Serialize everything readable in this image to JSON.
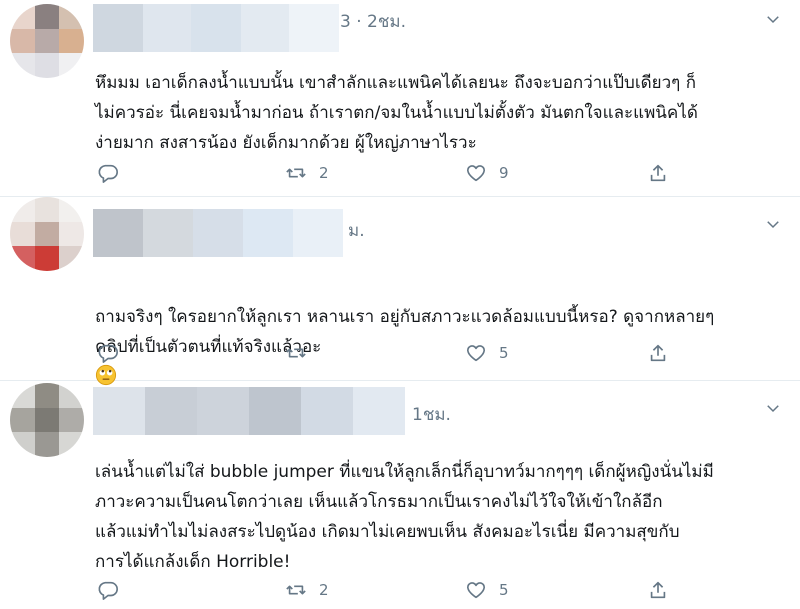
{
  "tweets": [
    {
      "time": "3 · 2ชม.",
      "text": "หึมมม เอาเด็กลงน้ำแบบนั้น เขาสำลักและแพนิคได้เลยนะ ถึงจะบอกว่าแป๊บเดียวๆ ก็\nไม่ควรอ่ะ นี่เคยจมน้ำมาก่อน ถ้าเราตก/จมในน้ำแบบไม่ตั้งตัว มันตกใจและแพนิคได้\nง่ายมาก สงสารน้อง ยังเด็กมากด้วย ผู้ใหญ่ภาษาไรวะ",
      "retweets": "2",
      "likes": "9"
    },
    {
      "time": "ม.",
      "text": "ถามจริงๆ ใครอยากให้ลูกเรา หลานเรา อยู่กับสภาวะแวดล้อมแบบนี้หรอ? ดูจากหลายๆ\nคลิปที่เป็นตัวตนที่แท้จริงแล้วอะ",
      "retweets": "",
      "likes": "5",
      "emoji": "rolling-eyes-emoji"
    },
    {
      "time": "1ชม.",
      "text": "เล่นน้ำแต่ไม่ใส่ bubble jumper ที่แขนให้ลูกเล็กนี่ก็อุบาทว์มากๆๆๆ เด็กผู้หญิงนั่นไม่มี\nภาวะความเป็นคนโตกว่าเลย เห็นแล้วโกรธมากเป็นเราคงไม่ไว้ใจให้เข้าใกล้อีก\nแล้วแม่ทำไมไม่ลงสระไปดูน้อง  เกิดมาไม่เคยพบเห็น สังคมอะไรเนี่ย มีความสุขกับ\nการได้แกล้งเด็ก  Horrible!",
      "retweets": "2",
      "likes": "5"
    }
  ],
  "colors": {
    "muted": "#657786",
    "divider": "#e6ecf0"
  },
  "icons": [
    "reply-icon",
    "retweet-icon",
    "like-icon",
    "share-icon",
    "chevron-down-icon"
  ]
}
